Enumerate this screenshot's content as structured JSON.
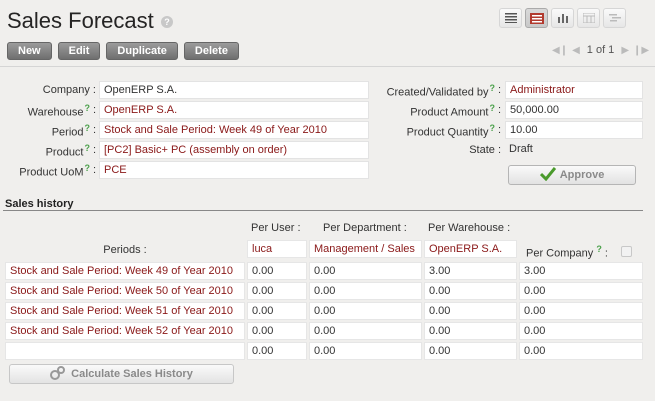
{
  "header": {
    "title": "Sales Forecast",
    "help": "?"
  },
  "views": [
    "list-view-icon",
    "form-view-icon",
    "graph-view-icon",
    "calendar-view-icon",
    "gantt-view-icon"
  ],
  "toolbar": {
    "new": "New",
    "edit": "Edit",
    "duplicate": "Duplicate",
    "delete": "Delete"
  },
  "pager": {
    "count": "1 of 1"
  },
  "form": {
    "company_label": "Company :",
    "company": "OpenERP S.A.",
    "warehouse_label": "Warehouse",
    "warehouse": "OpenERP S.A.",
    "period_label": "Period",
    "period": "Stock and Sale Period: Week 49 of Year 2010",
    "product_label": "Product",
    "product": "[PC2] Basic+ PC (assembly on order)",
    "uom_label": "Product UoM",
    "uom": "PCE",
    "created_label": "Created/Validated by",
    "created": "Administrator",
    "amount_label": "Product Amount",
    "amount": "50,000.00",
    "quantity_label": "Product Quantity",
    "quantity": "10.00",
    "state_label": "State :",
    "state": "Draft",
    "colon": ":",
    "q": "?"
  },
  "approve_label": "Approve",
  "history": {
    "title": "Sales history",
    "per_user": "Per User :",
    "per_department": "Per Department :",
    "per_warehouse": "Per Warehouse :",
    "periods_label": "Periods :",
    "user": "luca",
    "department": "Management / Sales",
    "warehouse": "OpenERP S.A.",
    "per_company": "Per Company",
    "rows": [
      {
        "period": "Stock and Sale Period: Week 49 of Year 2010",
        "user": "0.00",
        "department": "0.00",
        "warehouse": "3.00",
        "company": "3.00"
      },
      {
        "period": "Stock and Sale Period: Week 50 of Year 2010",
        "user": "0.00",
        "department": "0.00",
        "warehouse": "0.00",
        "company": "0.00"
      },
      {
        "period": "Stock and Sale Period: Week 51 of Year 2010",
        "user": "0.00",
        "department": "0.00",
        "warehouse": "0.00",
        "company": "0.00"
      },
      {
        "period": "Stock and Sale Period: Week 52 of Year 2010",
        "user": "0.00",
        "department": "0.00",
        "warehouse": "0.00",
        "company": "0.00"
      },
      {
        "period": "",
        "user": "0.00",
        "department": "0.00",
        "warehouse": "0.00",
        "company": "0.00"
      }
    ],
    "calc_label": "Calculate Sales History"
  }
}
